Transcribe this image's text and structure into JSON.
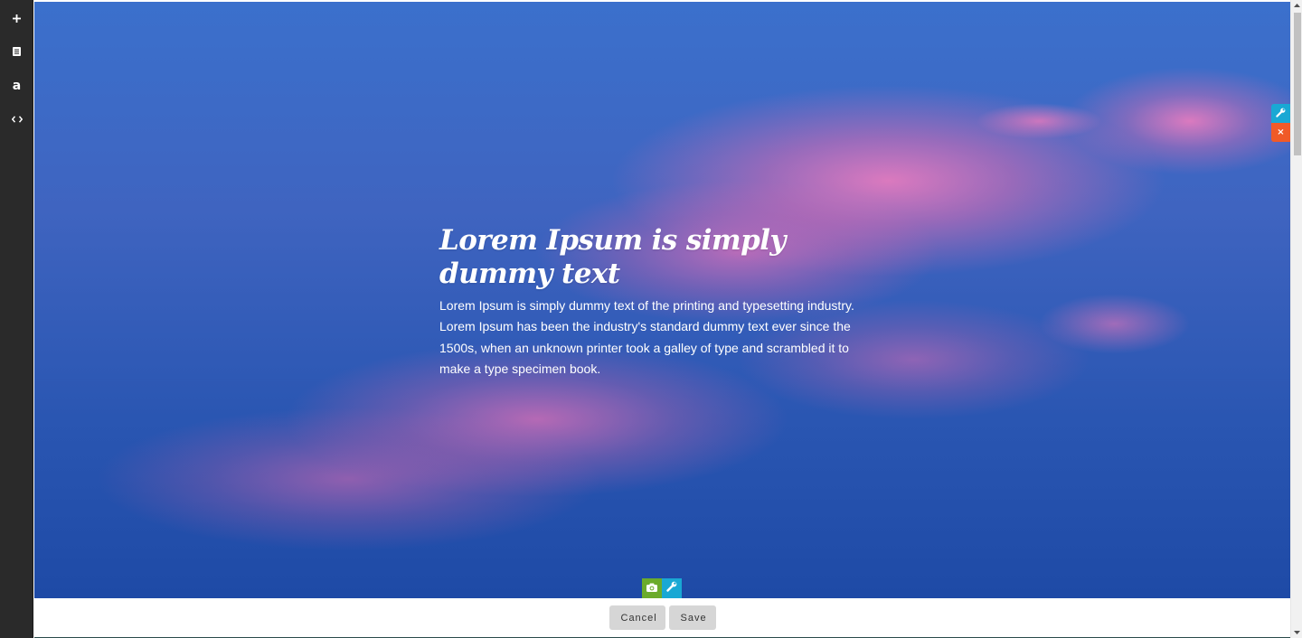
{
  "sidebar": {
    "tools": [
      {
        "icon": "plus-icon"
      },
      {
        "icon": "document-icon"
      },
      {
        "label": "a",
        "icon": "text-icon"
      },
      {
        "icon": "code-icon"
      }
    ]
  },
  "hero": {
    "title": "Lorem Ipsum is simply dummy text",
    "body": "Lorem Ipsum is simply dummy text of the printing and typesetting industry. Lorem Ipsum has been the industry's standard dummy text ever since the 1500s, when an unknown printer took a galley of type and scrambled it to make a type specimen book."
  },
  "section_controls": {
    "edit_icon": "wrench-icon",
    "remove_label": "×",
    "edit_color": "#19a8d4",
    "remove_color": "#f05a28"
  },
  "background_controls": {
    "photo_icon": "camera-icon",
    "edit_icon": "wrench-icon",
    "photo_color": "#6bab2c",
    "edit_color": "#19a8d4"
  },
  "footer": {
    "cancel_label": "Cancel",
    "save_label": "Save"
  },
  "colors": {
    "sidebar": "#2a2a2a",
    "hero_top": "#3b70cc",
    "hero_bottom": "#1e4aa6",
    "cloud_pink": "#f67dbe",
    "button_bg": "#d6d6d6"
  }
}
